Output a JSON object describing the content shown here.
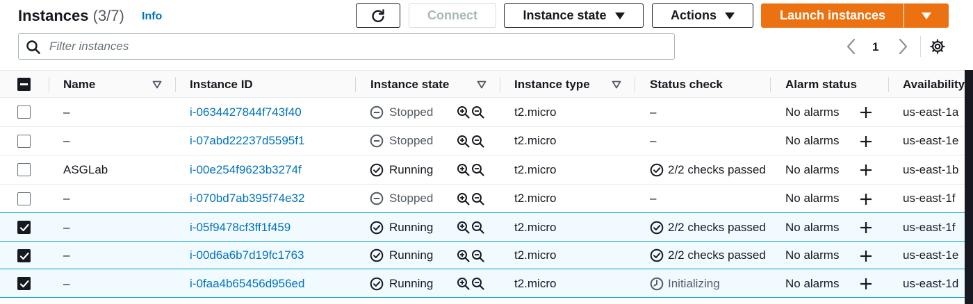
{
  "header": {
    "title": "Instances",
    "count": "(3/7)",
    "info_label": "Info",
    "connect_label": "Connect",
    "instance_state_label": "Instance state",
    "actions_label": "Actions",
    "launch_label": "Launch instances"
  },
  "filter": {
    "placeholder": "Filter instances",
    "value": ""
  },
  "pagination": {
    "current_page": "1"
  },
  "columns": [
    "Name",
    "Instance ID",
    "Instance state",
    "Instance type",
    "Status check",
    "Alarm status",
    "Availability"
  ],
  "rows": [
    {
      "selected": false,
      "name": "–",
      "id": "i-0634427844f743f40",
      "state": "Stopped",
      "type": "t2.micro",
      "status": "–",
      "status_kind": "none",
      "alarm": "No alarms",
      "az": "us-east-1a"
    },
    {
      "selected": false,
      "name": "–",
      "id": "i-07abd22237d5595f1",
      "state": "Stopped",
      "type": "t2.micro",
      "status": "–",
      "status_kind": "none",
      "alarm": "No alarms",
      "az": "us-east-1e"
    },
    {
      "selected": false,
      "name": "ASGLab",
      "id": "i-00e254f9623b3274f",
      "state": "Running",
      "type": "t2.micro",
      "status": "2/2 checks passed",
      "status_kind": "passed",
      "alarm": "No alarms",
      "az": "us-east-1b"
    },
    {
      "selected": false,
      "name": "–",
      "id": "i-070bd7ab395f74e32",
      "state": "Stopped",
      "type": "t2.micro",
      "status": "–",
      "status_kind": "none",
      "alarm": "No alarms",
      "az": "us-east-1f"
    },
    {
      "selected": true,
      "name": "–",
      "id": "i-05f9478cf3ff1f459",
      "state": "Running",
      "type": "t2.micro",
      "status": "2/2 checks passed",
      "status_kind": "passed",
      "alarm": "No alarms",
      "az": "us-east-1f"
    },
    {
      "selected": true,
      "name": "–",
      "id": "i-00d6a6b7d19fc1763",
      "state": "Running",
      "type": "t2.micro",
      "status": "2/2 checks passed",
      "status_kind": "passed",
      "alarm": "No alarms",
      "az": "us-east-1e"
    },
    {
      "selected": true,
      "name": "–",
      "id": "i-0faa4b65456d956ed",
      "state": "Running",
      "type": "t2.micro",
      "status": "Initializing",
      "status_kind": "initializing",
      "alarm": "No alarms",
      "az": "us-east-1d"
    }
  ],
  "icons": {
    "refresh": "refresh-icon",
    "search": "search-icon",
    "settings": "gear-icon",
    "stopped": "stopped-circle-icon",
    "running": "check-circle-icon",
    "zoom_in": "zoom-in-icon",
    "zoom_out": "zoom-out-icon",
    "add_alarm": "plus-icon",
    "initializing": "clock-icon"
  },
  "colors": {
    "accent": "#ec7211",
    "link": "#0073bb",
    "selected_row": "#f1faff",
    "selected_border": "#00a1c9"
  }
}
